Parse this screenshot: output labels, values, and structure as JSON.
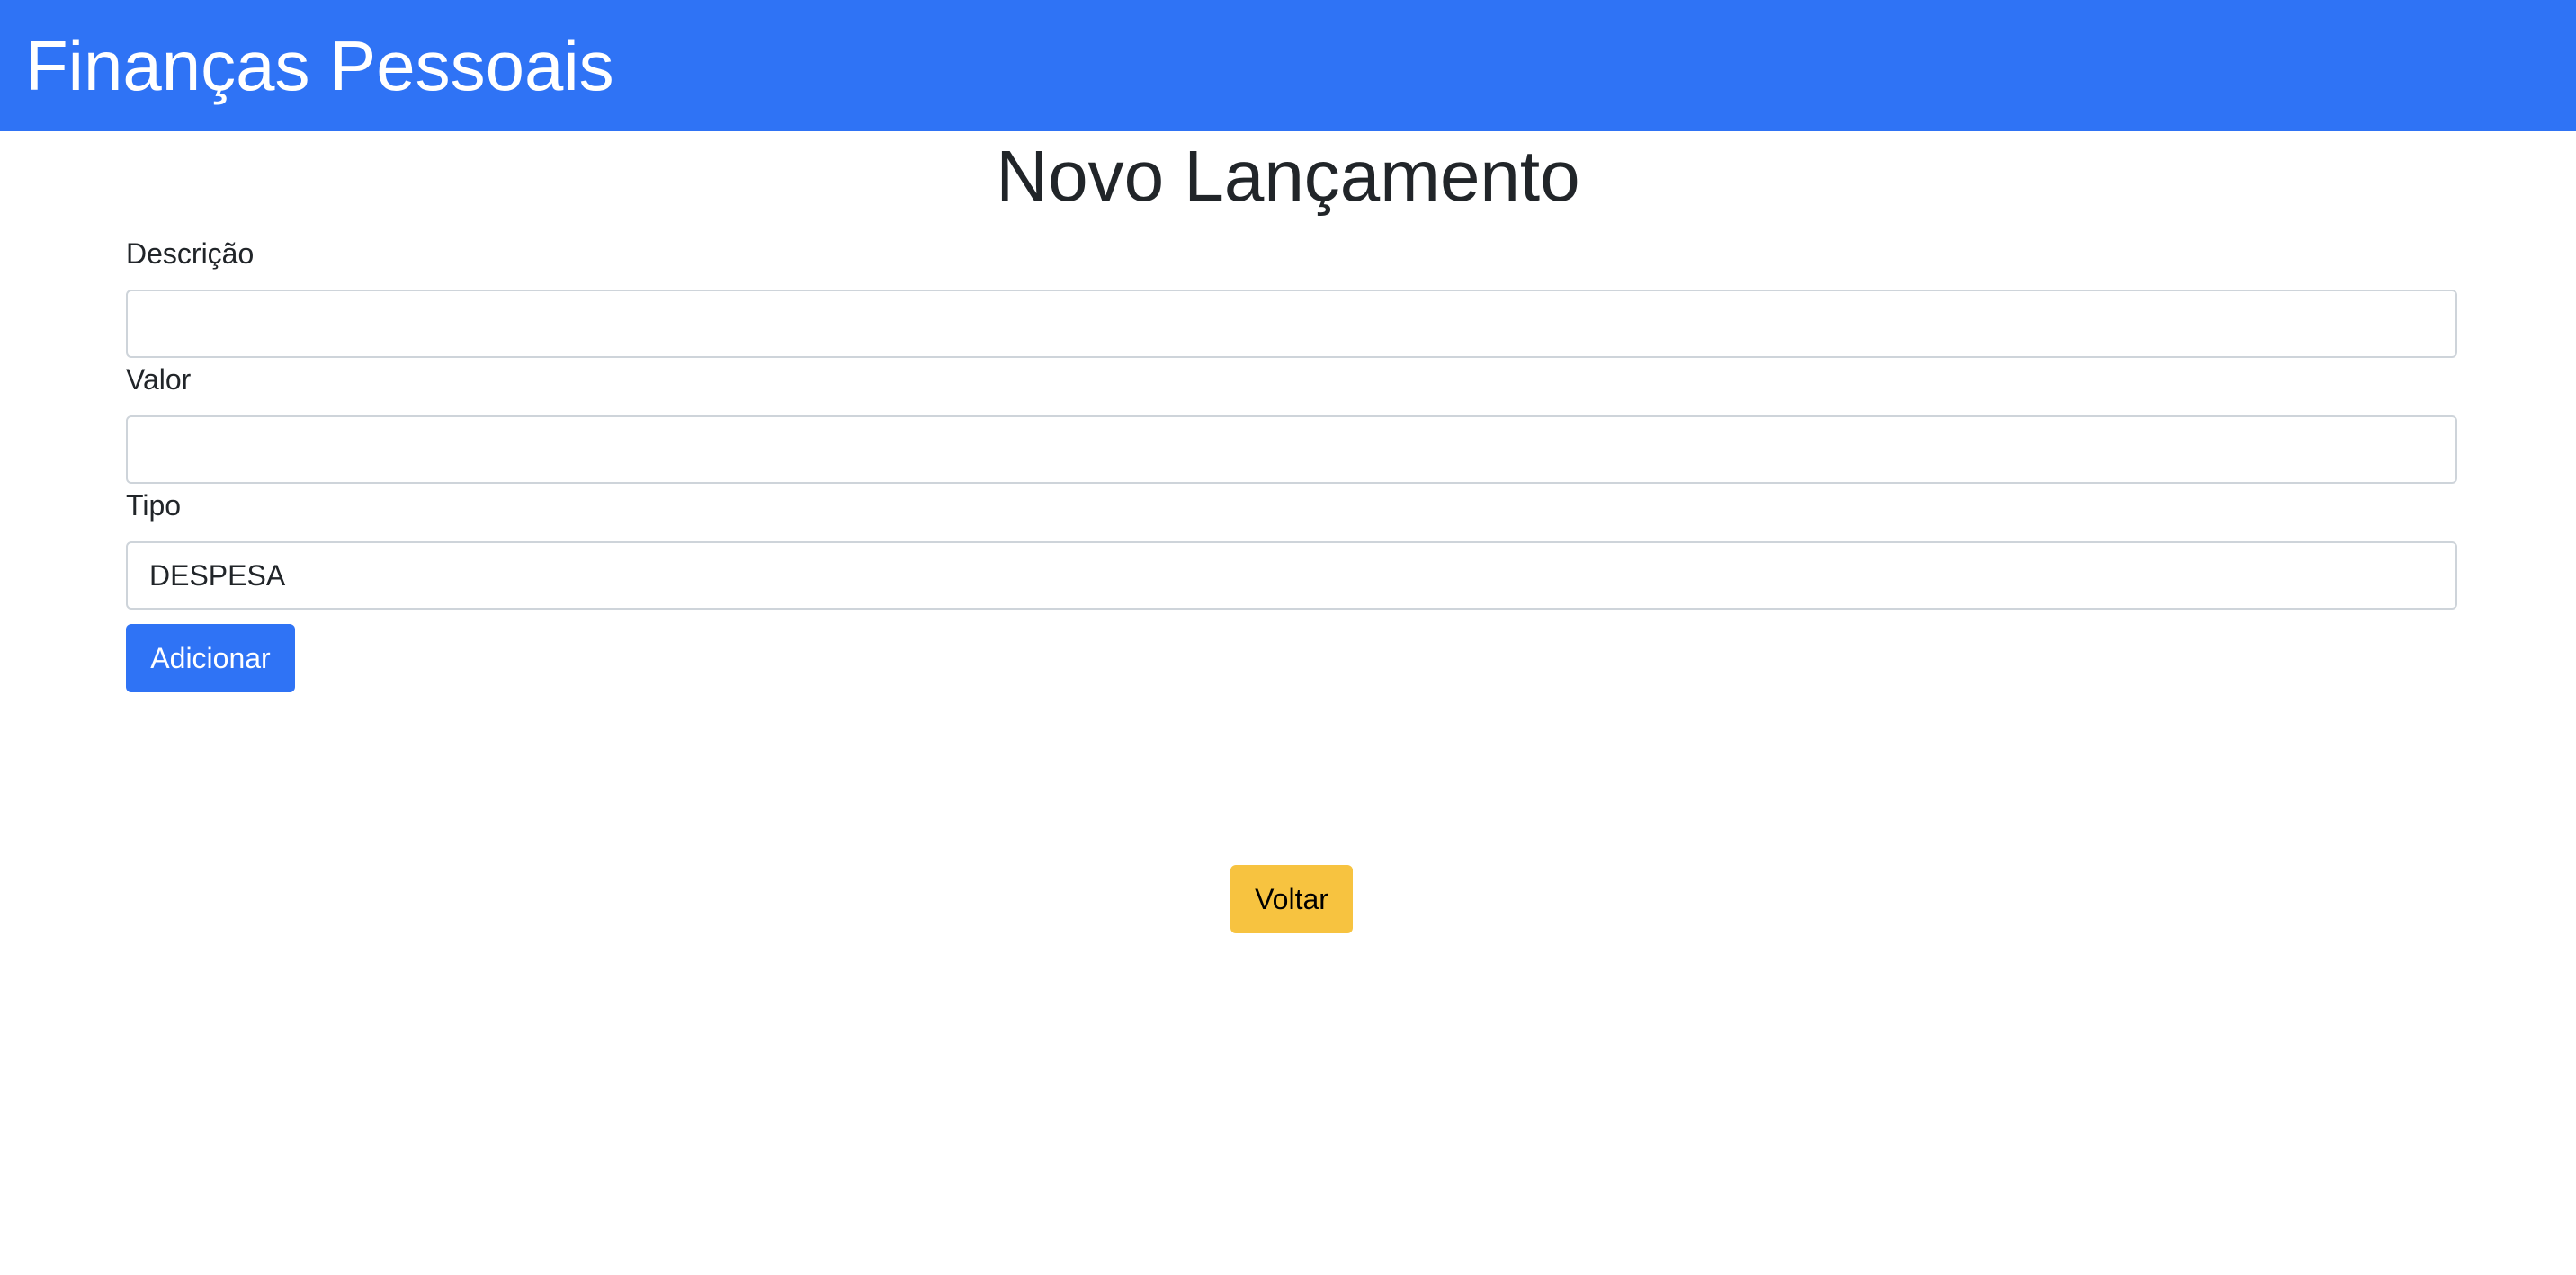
{
  "navbar": {
    "brand": "Finanças Pessoais",
    "background_color": "#2f73f5"
  },
  "page": {
    "title": "Novo Lançamento"
  },
  "form": {
    "descricao": {
      "label": "Descrição",
      "value": ""
    },
    "valor": {
      "label": "Valor",
      "value": ""
    },
    "tipo": {
      "label": "Tipo",
      "value": "DESPESA"
    },
    "submit_label": "Adicionar",
    "submit_color": "#2f73f5"
  },
  "back_button": {
    "label": "Voltar",
    "color": "#f7c340"
  }
}
